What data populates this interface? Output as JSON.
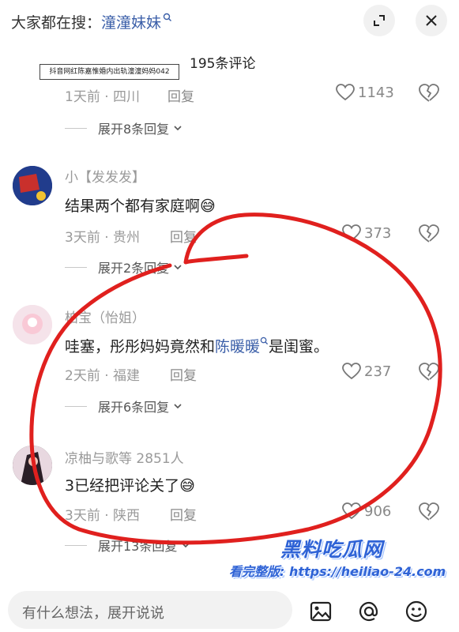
{
  "topbar": {
    "prefix": "大家都在搜：",
    "search_term": "潼潼妹妹",
    "search_icon": "search-icon",
    "collapse_icon": "collapse-icon",
    "close_icon": "close-icon"
  },
  "comment_count": "195条评论",
  "watermark_caption": "抖音网红陈嘉惟婚内出轨潼潼妈妈042",
  "comments": [
    {
      "meta": "1天前 · 四川",
      "reply_label": "回复",
      "likes": "1143",
      "expand_label": "展开8条回复"
    },
    {
      "username": "小【发发发】",
      "text": "结果两个都有家庭啊",
      "emoji": "😅",
      "meta": "3天前 · 贵州",
      "reply_label": "回复",
      "likes": "373",
      "expand_label": "展开2条回复"
    },
    {
      "username": "柏宝（怡姐）",
      "text_before": "哇塞，彤彤妈妈竟然和",
      "mention": "陈暖暖",
      "text_after": "是闺蜜。",
      "meta": "2天前 · 福建",
      "reply_label": "回复",
      "likes": "237",
      "expand_label": "展开6条回复"
    },
    {
      "username": "凉柚与歌等 2851人",
      "text": "3已经把评论关了",
      "emoji": "😅",
      "meta": "3天前 · 陕西",
      "reply_label": "回复",
      "likes": "906",
      "expand_label": "展开13条回复"
    }
  ],
  "input_placeholder": "有什么想法，展开说说",
  "bottom_icons": [
    "image-icon",
    "at-icon",
    "emoji-icon"
  ],
  "watermark_logo": "黑料吃瓜网",
  "watermark_url": "看完整版: https://heiliao-24.com",
  "colors": {
    "link": "#3a5ea8",
    "annotation": "#e0201e",
    "watermark": "#2f63d6"
  }
}
